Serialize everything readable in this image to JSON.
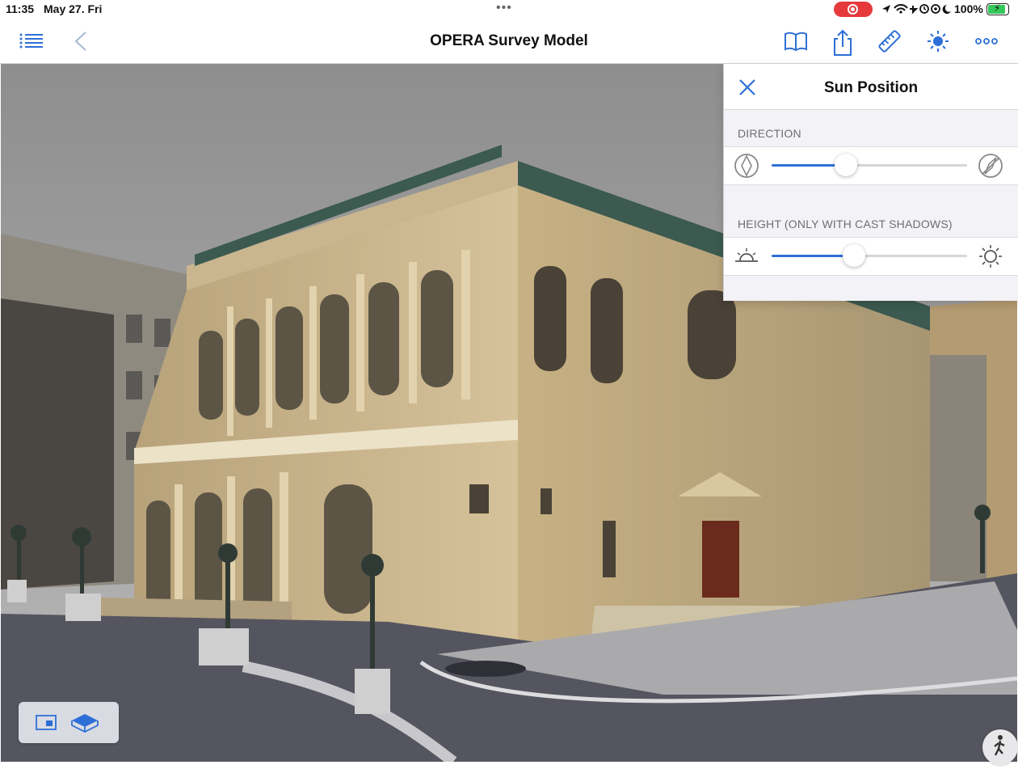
{
  "status_bar": {
    "time": "11:35",
    "date": "May 27. Fri",
    "battery": "100%",
    "battery_level": 1.0
  },
  "nav": {
    "title": "OPERA Survey Model"
  },
  "sun_panel": {
    "title": "Sun Position",
    "direction_label": "DIRECTION",
    "height_label": "HEIGHT (ONLY WITH CAST SHADOWS)",
    "direction_value": 0.38,
    "height_value": 0.42
  },
  "colors": {
    "accent": "#2d6fd6",
    "record": "#e5393b",
    "battery": "#34c759"
  },
  "icons": {
    "menu": "list-icon",
    "back": "chevron-left-icon",
    "book": "book-icon",
    "share": "share-icon",
    "measure": "ruler-icon",
    "sun": "sun-icon",
    "more": "ellipsis-icon"
  }
}
